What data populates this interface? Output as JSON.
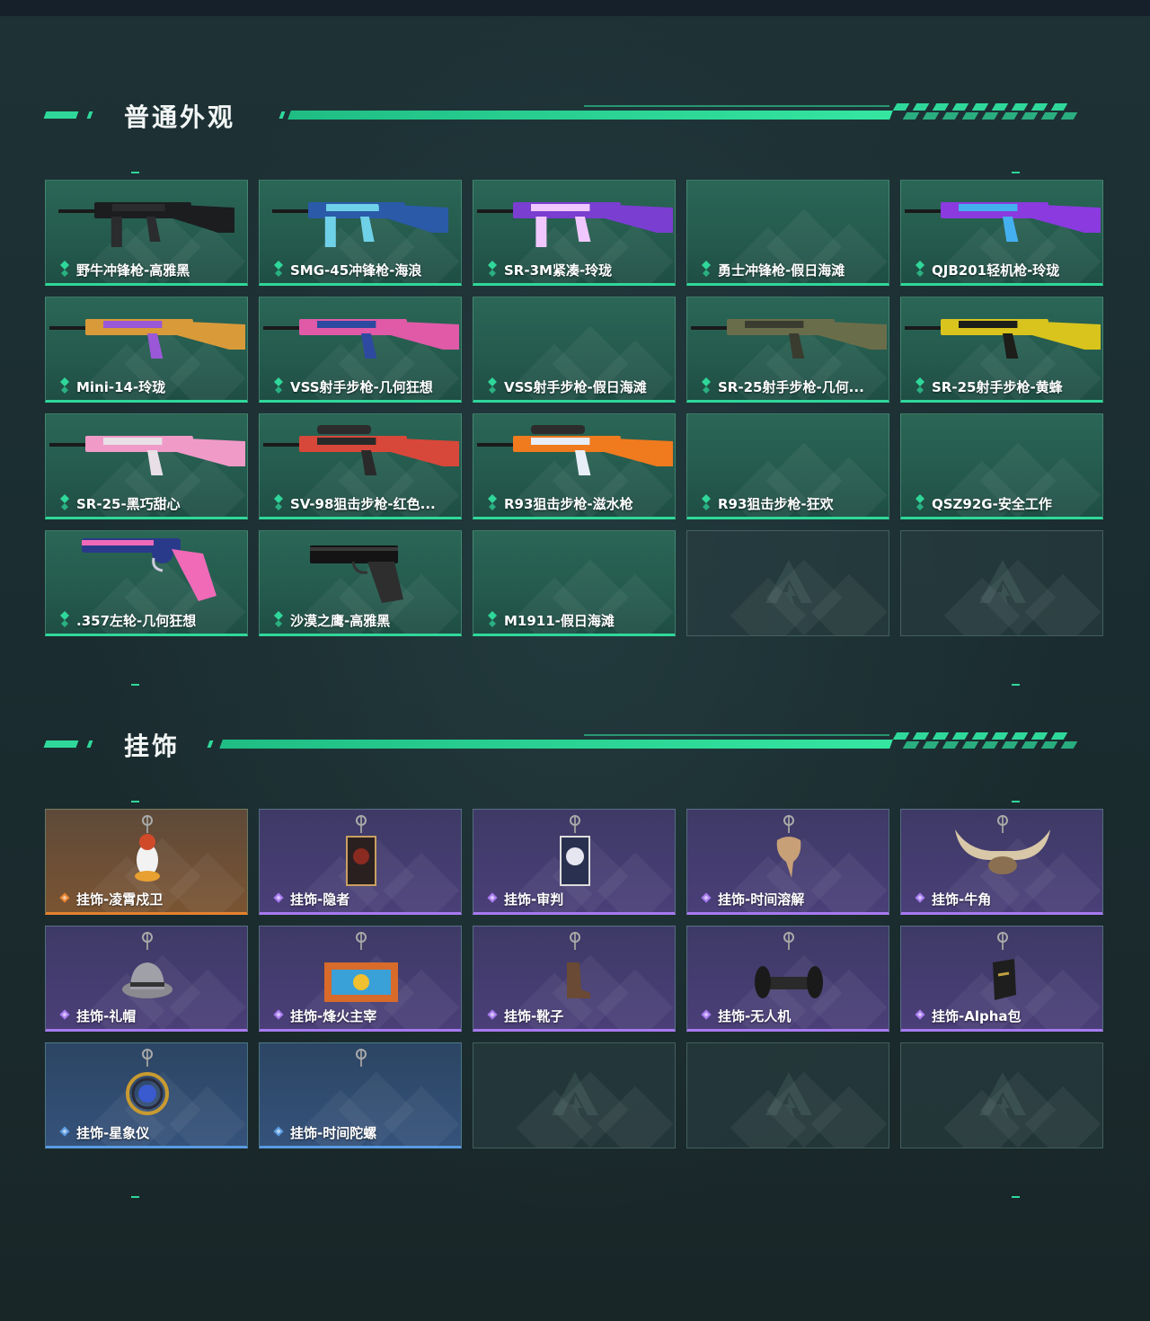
{
  "sections": {
    "skins": {
      "title": "普通外观"
    },
    "charms": {
      "title": "挂饰"
    }
  },
  "colors": {
    "accent": "#2fd89a",
    "rarity_orange": "#e5822e",
    "rarity_purple": "#a77af0",
    "rarity_blue": "#5a9ae0"
  },
  "skins": [
    {
      "label": "野牛冲锋枪-高雅黑",
      "rarity": "green",
      "icon": "smg-black"
    },
    {
      "label": "SMG-45冲锋枪-海浪",
      "rarity": "green",
      "icon": "smg-wave"
    },
    {
      "label": "SR-3M紧凑-玲珑",
      "rarity": "green",
      "icon": "rifle-purple"
    },
    {
      "label": "勇士冲锋枪-假日海滩",
      "rarity": "green",
      "icon": "none"
    },
    {
      "label": "QJB201轻机枪-玲珑",
      "rarity": "green",
      "icon": "lmg-purple"
    },
    {
      "label": "Mini-14-玲珑",
      "rarity": "green",
      "icon": "rifle-gradient"
    },
    {
      "label": "VSS射手步枪-几何狂想",
      "rarity": "green",
      "icon": "rifle-pink"
    },
    {
      "label": "VSS射手步枪-假日海滩",
      "rarity": "green",
      "icon": "none"
    },
    {
      "label": "SR-25射手步枪-几何...",
      "rarity": "green",
      "icon": "rifle-camo"
    },
    {
      "label": "SR-25射手步枪-黄蜂",
      "rarity": "green",
      "icon": "rifle-yellow"
    },
    {
      "label": "SR-25-黑巧甜心",
      "rarity": "green",
      "icon": "rifle-pinkcamo"
    },
    {
      "label": "SV-98狙击步枪-红色...",
      "rarity": "green",
      "icon": "sniper-red"
    },
    {
      "label": "R93狙击步枪-滋水枪",
      "rarity": "green",
      "icon": "sniper-orange"
    },
    {
      "label": "R93狙击步枪-狂欢",
      "rarity": "green",
      "icon": "none"
    },
    {
      "label": "QSZ92G-安全工作",
      "rarity": "green",
      "icon": "none"
    },
    {
      "label": ".357左轮-几何狂想",
      "rarity": "green",
      "icon": "revolver-pink"
    },
    {
      "label": "沙漠之鹰-高雅黑",
      "rarity": "green",
      "icon": "pistol-black"
    },
    {
      "label": "M1911-假日海滩",
      "rarity": "green",
      "icon": "none"
    },
    {
      "label": "",
      "rarity": "empty",
      "icon": "logo-icon"
    },
    {
      "label": "",
      "rarity": "empty",
      "icon": "logo-icon"
    }
  ],
  "charms": [
    {
      "label": "挂饰-凌霄戍卫",
      "rarity": "orange",
      "icon": "charm-penguin"
    },
    {
      "label": "挂饰-隐者",
      "rarity": "purple",
      "icon": "charm-card"
    },
    {
      "label": "挂饰-审判",
      "rarity": "purple",
      "icon": "charm-card-white"
    },
    {
      "label": "挂饰-时间溶解",
      "rarity": "purple",
      "icon": "charm-melt"
    },
    {
      "label": "挂饰-牛角",
      "rarity": "purple",
      "icon": "charm-horns"
    },
    {
      "label": "挂饰-礼帽",
      "rarity": "purple",
      "icon": "charm-hat"
    },
    {
      "label": "挂饰-烽火主宰",
      "rarity": "purple",
      "icon": "charm-container"
    },
    {
      "label": "挂饰-靴子",
      "rarity": "purple",
      "icon": "charm-boot"
    },
    {
      "label": "挂饰-无人机",
      "rarity": "purple",
      "icon": "charm-drone"
    },
    {
      "label": "挂饰-Alpha包",
      "rarity": "purple",
      "icon": "charm-bag"
    },
    {
      "label": "挂饰-星象仪",
      "rarity": "blue",
      "icon": "charm-astrolabe"
    },
    {
      "label": "挂饰-时间陀螺",
      "rarity": "blue",
      "icon": "none"
    },
    {
      "label": "",
      "rarity": "empty",
      "icon": "logo-icon"
    },
    {
      "label": "",
      "rarity": "empty",
      "icon": "logo-icon"
    },
    {
      "label": "",
      "rarity": "empty",
      "icon": "logo-icon"
    }
  ]
}
